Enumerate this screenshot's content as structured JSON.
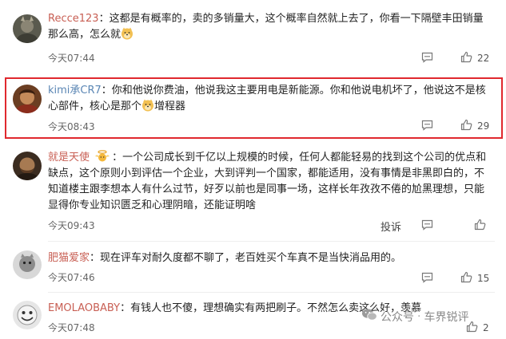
{
  "comments": [
    {
      "username": "Recce123",
      "text": "：这都是有概率的，卖的多销量大，这个概率自然就上去了，你看一下隔壁丰田销量那么高，怎么就",
      "emoji_icon": "doge-emoji-icon",
      "time": "今天07:44",
      "likes": "22"
    },
    {
      "username": "kimi承CR7",
      "text_part1": "：你和他说你费油，他说我这主要用电是新能源。你和他说电机坏了，他说这不是核心部件，核心是那个",
      "emoji_icon": "doge-emoji-icon",
      "text_part2": "增程器",
      "time": "今天08:43",
      "likes": "29"
    },
    {
      "username": "就是天使",
      "badge_icon": "angel-badge-icon",
      "text": "：一个公司成长到千亿以上规模的时候，任何人都能轻易的找到这个公司的优点和缺点，这个原则小到评估一个企业，大到评判一个国家，都能适用，没有事情是非黑即白的，不知道楼主跟李想本人有什么过节，好歹以前也是同事一场，这样长年孜孜不倦的尬黑理想，只能显得你专业知识匮乏和心理阴暗，还能证明啥",
      "time": "今天09:43",
      "report_label": "投诉",
      "likes": ""
    },
    {
      "username": "肥猫爱家",
      "text": "：现在评车对耐久度都不聊了，老百姓买个车真不是当快消品用的。",
      "time": "今天07:46",
      "likes": "15"
    },
    {
      "username": "EMOLAOBABY",
      "text": "：有钱人也不傻，理想确实有两把刷子。不然怎么卖这么好，羡慕",
      "time": "今天07:48",
      "likes": "2"
    }
  ],
  "watermark": {
    "prefix": "公众号",
    "separator": "·",
    "name": "车界锐评"
  },
  "colors": {
    "username_red": "#c85f54",
    "username_blue": "#5a86b4",
    "highlight_border": "#e0282e"
  }
}
